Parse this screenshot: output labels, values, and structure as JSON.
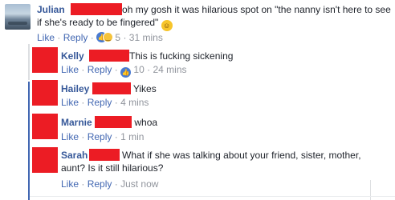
{
  "comments": [
    {
      "name": "Julian",
      "text_line1": "oh my gosh it was hilarious spot on \"the nanny isn't here to see",
      "text_line2": "if she's ready to be fingered\"",
      "emoji": "grinning-sweat-emoji",
      "like": "Like",
      "reply": "Reply",
      "reaction_count": "5",
      "time": "31 mins"
    },
    {
      "name": "Kelly",
      "text": "This is fucking sickening",
      "like": "Like",
      "reply": "Reply",
      "reaction_count": "10",
      "time": "24 mins"
    },
    {
      "name": "Hailey",
      "text": "Yikes",
      "like": "Like",
      "reply": "Reply",
      "time": "4 mins"
    },
    {
      "name": "Marnie",
      "text": "whoa",
      "like": "Like",
      "reply": "Reply",
      "time": "1 min"
    },
    {
      "name": "Sarah",
      "text_line1": "What if she was talking about your friend, sister, mother,",
      "text_line2": "aunt? Is it still hilarious?",
      "like": "Like",
      "reply": "Reply",
      "time": "Just now"
    }
  ],
  "separator": "·",
  "colors": {
    "link": "#4267b2",
    "name": "#365899",
    "meta": "#90949c",
    "redaction": "#ec1c24",
    "thread": "#4267b2"
  }
}
